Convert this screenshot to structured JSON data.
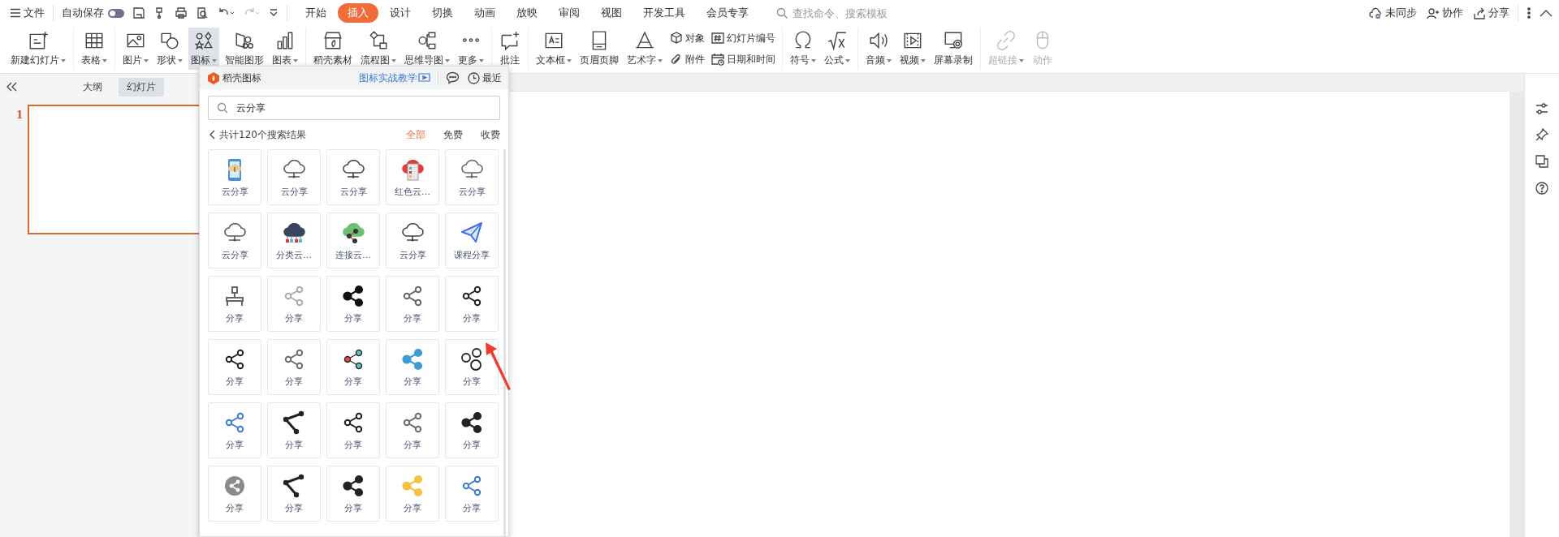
{
  "menu_bar": {
    "file_menu": "文件",
    "autosave": {
      "label": "自动保存",
      "on": false
    },
    "tabs": [
      {
        "label": "开始",
        "selected": false
      },
      {
        "label": "插入",
        "selected": true
      },
      {
        "label": "设计",
        "selected": false
      },
      {
        "label": "切换",
        "selected": false
      },
      {
        "label": "动画",
        "selected": false
      },
      {
        "label": "放映",
        "selected": false
      },
      {
        "label": "审阅",
        "selected": false
      },
      {
        "label": "视图",
        "selected": false
      },
      {
        "label": "开发工具",
        "selected": false
      },
      {
        "label": "会员专享",
        "selected": false
      }
    ],
    "search": {
      "placeholder": "查找命令、搜索模板"
    },
    "actions": [
      {
        "label": "未同步"
      },
      {
        "label": "协作"
      },
      {
        "label": "分享"
      }
    ]
  },
  "ribbon": {
    "groups": [
      {
        "items": [
          {
            "kind": "large",
            "label": "新建幻灯片",
            "dropdown": true,
            "active": false,
            "disabled": false
          }
        ]
      },
      {
        "items": [
          {
            "kind": "large",
            "label": "表格",
            "dropdown": true,
            "active": false,
            "disabled": false
          }
        ]
      },
      {
        "items": [
          {
            "kind": "large",
            "label": "图片",
            "dropdown": true,
            "active": false,
            "disabled": false
          },
          {
            "kind": "large",
            "label": "形状",
            "dropdown": true,
            "active": false,
            "disabled": false
          },
          {
            "kind": "large",
            "label": "图标",
            "dropdown": true,
            "active": true,
            "disabled": false
          },
          {
            "kind": "large",
            "label": "智能图形",
            "dropdown": false,
            "active": false,
            "disabled": false
          },
          {
            "kind": "large",
            "label": "图表",
            "dropdown": true,
            "active": false,
            "disabled": false
          }
        ]
      },
      {
        "items": [
          {
            "kind": "large",
            "label": "稻壳素材",
            "dropdown": false,
            "active": false,
            "disabled": false
          },
          {
            "kind": "large",
            "label": "流程图",
            "dropdown": true,
            "active": false,
            "disabled": false
          },
          {
            "kind": "large",
            "label": "思维导图",
            "dropdown": true,
            "active": false,
            "disabled": false
          },
          {
            "kind": "large",
            "label": "更多",
            "dropdown": true,
            "active": false,
            "disabled": false
          }
        ]
      },
      {
        "items": [
          {
            "kind": "large",
            "label": "批注",
            "dropdown": false,
            "active": false,
            "disabled": false
          }
        ]
      },
      {
        "items": [
          {
            "kind": "large",
            "label": "文本框",
            "dropdown": true,
            "active": false,
            "disabled": false
          },
          {
            "kind": "large",
            "label": "页眉页脚",
            "dropdown": false,
            "active": false,
            "disabled": false
          },
          {
            "kind": "large",
            "label": "艺术字",
            "dropdown": true,
            "active": false,
            "disabled": false
          },
          {
            "kind": "small",
            "label": "对象",
            "dropdown": false,
            "active": false,
            "disabled": false
          },
          {
            "kind": "small",
            "label": "附件",
            "dropdown": false,
            "active": false,
            "disabled": false
          },
          {
            "kind": "small",
            "label": "幻灯片编号",
            "dropdown": false,
            "active": false,
            "disabled": false
          },
          {
            "kind": "small",
            "label": "日期和时间",
            "dropdown": false,
            "active": false,
            "disabled": false
          }
        ]
      },
      {
        "items": [
          {
            "kind": "large",
            "label": "符号",
            "dropdown": true,
            "active": false,
            "disabled": false
          },
          {
            "kind": "large",
            "label": "公式",
            "dropdown": true,
            "active": false,
            "disabled": false
          }
        ]
      },
      {
        "items": [
          {
            "kind": "large",
            "label": "音频",
            "dropdown": true,
            "active": false,
            "disabled": false
          },
          {
            "kind": "large",
            "label": "视频",
            "dropdown": true,
            "active": false,
            "disabled": false
          },
          {
            "kind": "large",
            "label": "屏幕录制",
            "dropdown": false,
            "active": false,
            "disabled": false
          }
        ]
      },
      {
        "items": [
          {
            "kind": "large",
            "label": "超链接",
            "dropdown": true,
            "active": false,
            "disabled": true
          },
          {
            "kind": "large",
            "label": "动作",
            "dropdown": false,
            "active": false,
            "disabled": true
          }
        ]
      }
    ]
  },
  "slide_pane": {
    "tabs": [
      {
        "label": "大纲",
        "selected": false
      },
      {
        "label": "幻灯片",
        "selected": true
      }
    ],
    "slides": [
      {
        "number": "1",
        "selected": true
      }
    ]
  },
  "icon_panel": {
    "title": "稻壳图标",
    "tutorial_link": "图标实战教学",
    "recent": "最近",
    "search": {
      "value": "云分享"
    },
    "result_count": "共计120个搜索结果",
    "filters": [
      {
        "label": "全部",
        "selected": true
      },
      {
        "label": "免费",
        "selected": false
      },
      {
        "label": "收费",
        "selected": false
      }
    ],
    "results": [
      {
        "label": "云分享",
        "kind": "phone",
        "color": "#4a90d9"
      },
      {
        "label": "云分享",
        "kind": "cloud",
        "color": "#555555"
      },
      {
        "label": "云分享",
        "kind": "cloud",
        "color": "#444444"
      },
      {
        "label": "红色云…",
        "kind": "cloud-doc",
        "color": "#e8383d"
      },
      {
        "label": "云分享",
        "kind": "cloud",
        "color": "#666666"
      },
      {
        "label": "云分享",
        "kind": "cloud",
        "color": "#555555"
      },
      {
        "label": "分类云…",
        "kind": "cloud-bars",
        "color": "#3a4560"
      },
      {
        "label": "连接云…",
        "kind": "cloud-link",
        "color": "#6cc070"
      },
      {
        "label": "云分享",
        "kind": "cloud",
        "color": "#444444"
      },
      {
        "label": "课程分享",
        "kind": "plane",
        "color": "#3d6fe8"
      },
      {
        "label": "分享",
        "kind": "network",
        "color": "#666666"
      },
      {
        "label": "分享",
        "kind": "share",
        "color": "#aaaaaa"
      },
      {
        "label": "分享",
        "kind": "share-solid",
        "color": "#111111"
      },
      {
        "label": "分享",
        "kind": "share",
        "color": "#666666"
      },
      {
        "label": "分享",
        "kind": "share",
        "color": "#222222"
      },
      {
        "label": "分享",
        "kind": "share",
        "color": "#222222"
      },
      {
        "label": "分享",
        "kind": "share",
        "color": "#6b6b70"
      },
      {
        "label": "分享",
        "kind": "share-dots",
        "color": "#2a2a2a"
      },
      {
        "label": "分享",
        "kind": "share-solid",
        "color": "#3e9bd3"
      },
      {
        "label": "分享",
        "kind": "share-bubble",
        "color": "#222222"
      },
      {
        "label": "分享",
        "kind": "share",
        "color": "#3d7bd0"
      },
      {
        "label": "分享",
        "kind": "share-angle",
        "color": "#222222"
      },
      {
        "label": "分享",
        "kind": "share",
        "color": "#1e1e1e"
      },
      {
        "label": "分享",
        "kind": "share",
        "color": "#6b6b70"
      },
      {
        "label": "分享",
        "kind": "share-solid",
        "color": "#222222"
      },
      {
        "label": "分享",
        "kind": "share-circle",
        "color": "#8a8a8a"
      },
      {
        "label": "分享",
        "kind": "share-angle",
        "color": "#222222"
      },
      {
        "label": "分享",
        "kind": "share-solid",
        "color": "#222222"
      },
      {
        "label": "分享",
        "kind": "share-solid",
        "color": "#f5c242"
      },
      {
        "label": "分享",
        "kind": "share",
        "color": "#3d7bd0"
      }
    ]
  }
}
